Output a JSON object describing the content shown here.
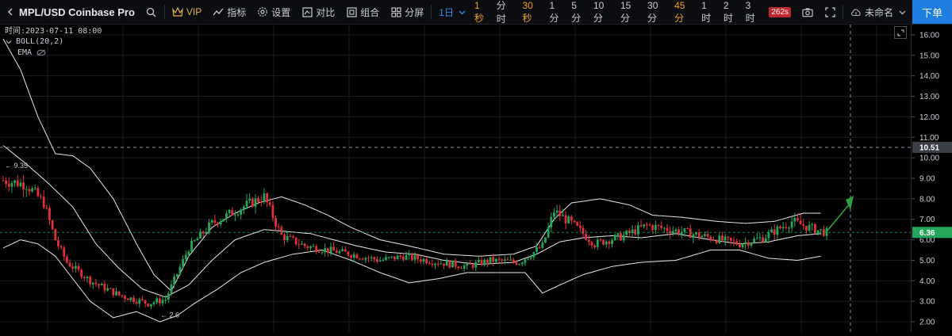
{
  "toolbar": {
    "symbol": "MPL/USD Coinbase Pro",
    "vip": "VIP",
    "indicators": "指标",
    "settings": "设置",
    "compare": "对比",
    "combine": "组合",
    "split": "分屏",
    "intervals": [
      "1秒",
      "分时",
      "30秒",
      "1分",
      "5分",
      "10分",
      "15分",
      "30分",
      "45分",
      "1时",
      "2时",
      "3时"
    ],
    "interval_styles": [
      "orange",
      "",
      "orange",
      "",
      "",
      "",
      "",
      "",
      "orange",
      "",
      "",
      ""
    ],
    "active_interval": "1日",
    "badge": "262s",
    "layout_name": "未命名",
    "order_button": "下单"
  },
  "legend": {
    "time": "时间:2023-07-11 08:00",
    "boll": "BOLL(20,2)",
    "ema": "EMA"
  },
  "colors": {
    "up": "#26a65b",
    "down": "#e0313b",
    "band": "#e8e8e8",
    "background": "#000000",
    "grid": "#1a1d22",
    "accent": "#1f7fe0",
    "arrow": "#2ea043"
  },
  "chart_data": {
    "type": "candlestick",
    "y_ticks": [
      2,
      3,
      4,
      5,
      6,
      7,
      8,
      9,
      10,
      11,
      12,
      13,
      14,
      15,
      16
    ],
    "ylim": [
      1.5,
      16.5
    ],
    "last_price": 6.36,
    "last_price_label": "6.36",
    "crosshair_price": 10.51,
    "crosshair_label": "10.51",
    "annotations": [
      {
        "text": "← 9.35",
        "value": 9.35,
        "index": 0
      },
      {
        "text": "← 2.6",
        "value": 2.6,
        "index": 52
      }
    ],
    "close_anchors": [
      [
        0,
        8.9
      ],
      [
        8,
        8.7
      ],
      [
        14,
        7.8
      ],
      [
        18,
        6.0
      ],
      [
        22,
        4.9
      ],
      [
        30,
        4.0
      ],
      [
        40,
        3.3
      ],
      [
        50,
        2.9
      ],
      [
        56,
        3.1
      ],
      [
        64,
        5.6
      ],
      [
        72,
        6.8
      ],
      [
        84,
        7.7
      ],
      [
        90,
        8.1
      ],
      [
        96,
        6.2
      ],
      [
        104,
        5.7
      ],
      [
        112,
        5.5
      ],
      [
        120,
        5.3
      ],
      [
        130,
        5.0
      ],
      [
        138,
        5.2
      ],
      [
        150,
        4.9
      ],
      [
        160,
        4.7
      ],
      [
        168,
        5.0
      ],
      [
        178,
        4.9
      ],
      [
        186,
        5.7
      ],
      [
        190,
        7.4
      ],
      [
        196,
        6.8
      ],
      [
        204,
        5.8
      ],
      [
        214,
        6.2
      ],
      [
        222,
        6.7
      ],
      [
        234,
        6.4
      ],
      [
        244,
        6.1
      ],
      [
        254,
        5.8
      ],
      [
        262,
        6.1
      ],
      [
        272,
        6.9
      ],
      [
        280,
        6.5
      ],
      [
        284,
        6.36
      ]
    ],
    "upper_band_anchors": [
      [
        0,
        15.8
      ],
      [
        6,
        14.3
      ],
      [
        12,
        12.0
      ],
      [
        18,
        10.2
      ],
      [
        24,
        10.1
      ],
      [
        30,
        9.5
      ],
      [
        38,
        8.0
      ],
      [
        46,
        5.8
      ],
      [
        52,
        4.3
      ],
      [
        58,
        3.5
      ],
      [
        64,
        5.2
      ],
      [
        72,
        6.6
      ],
      [
        80,
        7.3
      ],
      [
        88,
        7.8
      ],
      [
        96,
        8.1
      ],
      [
        104,
        7.7
      ],
      [
        112,
        7.2
      ],
      [
        120,
        6.6
      ],
      [
        130,
        6.0
      ],
      [
        140,
        5.7
      ],
      [
        152,
        5.3
      ],
      [
        164,
        5.2
      ],
      [
        176,
        5.3
      ],
      [
        184,
        5.7
      ],
      [
        190,
        7.0
      ],
      [
        196,
        7.8
      ],
      [
        206,
        8.0
      ],
      [
        216,
        7.7
      ],
      [
        224,
        7.2
      ],
      [
        234,
        7.1
      ],
      [
        246,
        6.9
      ],
      [
        256,
        6.8
      ],
      [
        266,
        6.9
      ],
      [
        276,
        7.3
      ],
      [
        282,
        7.3
      ]
    ],
    "mid_band_anchors": [
      [
        0,
        10.6
      ],
      [
        8,
        9.7
      ],
      [
        16,
        8.7
      ],
      [
        24,
        7.6
      ],
      [
        32,
        5.8
      ],
      [
        40,
        4.6
      ],
      [
        48,
        3.6
      ],
      [
        56,
        3.2
      ],
      [
        64,
        3.8
      ],
      [
        72,
        5.0
      ],
      [
        80,
        6.0
      ],
      [
        90,
        6.5
      ],
      [
        98,
        6.4
      ],
      [
        106,
        6.3
      ],
      [
        114,
        6.0
      ],
      [
        122,
        5.7
      ],
      [
        132,
        5.4
      ],
      [
        142,
        5.3
      ],
      [
        152,
        5.0
      ],
      [
        164,
        4.8
      ],
      [
        176,
        4.9
      ],
      [
        184,
        5.3
      ],
      [
        192,
        5.9
      ],
      [
        200,
        6.1
      ],
      [
        210,
        6.2
      ],
      [
        220,
        6.1
      ],
      [
        232,
        6.3
      ],
      [
        244,
        6.0
      ],
      [
        254,
        5.8
      ],
      [
        264,
        5.9
      ],
      [
        274,
        6.2
      ],
      [
        282,
        6.3
      ]
    ],
    "lower_band_anchors": [
      [
        0,
        5.6
      ],
      [
        6,
        6.0
      ],
      [
        12,
        5.8
      ],
      [
        18,
        5.2
      ],
      [
        24,
        4.1
      ],
      [
        30,
        3.0
      ],
      [
        38,
        2.2
      ],
      [
        46,
        2.5
      ],
      [
        54,
        2.0
      ],
      [
        60,
        2.3
      ],
      [
        66,
        2.9
      ],
      [
        74,
        3.6
      ],
      [
        82,
        4.4
      ],
      [
        90,
        4.9
      ],
      [
        100,
        5.3
      ],
      [
        110,
        5.5
      ],
      [
        120,
        5.0
      ],
      [
        130,
        4.4
      ],
      [
        140,
        3.9
      ],
      [
        150,
        4.1
      ],
      [
        160,
        4.4
      ],
      [
        170,
        4.4
      ],
      [
        180,
        4.4
      ],
      [
        186,
        3.4
      ],
      [
        192,
        3.8
      ],
      [
        200,
        4.3
      ],
      [
        210,
        4.7
      ],
      [
        220,
        4.9
      ],
      [
        232,
        5.0
      ],
      [
        244,
        5.5
      ],
      [
        254,
        5.5
      ],
      [
        264,
        5.1
      ],
      [
        274,
        5.0
      ],
      [
        282,
        5.2
      ]
    ]
  }
}
